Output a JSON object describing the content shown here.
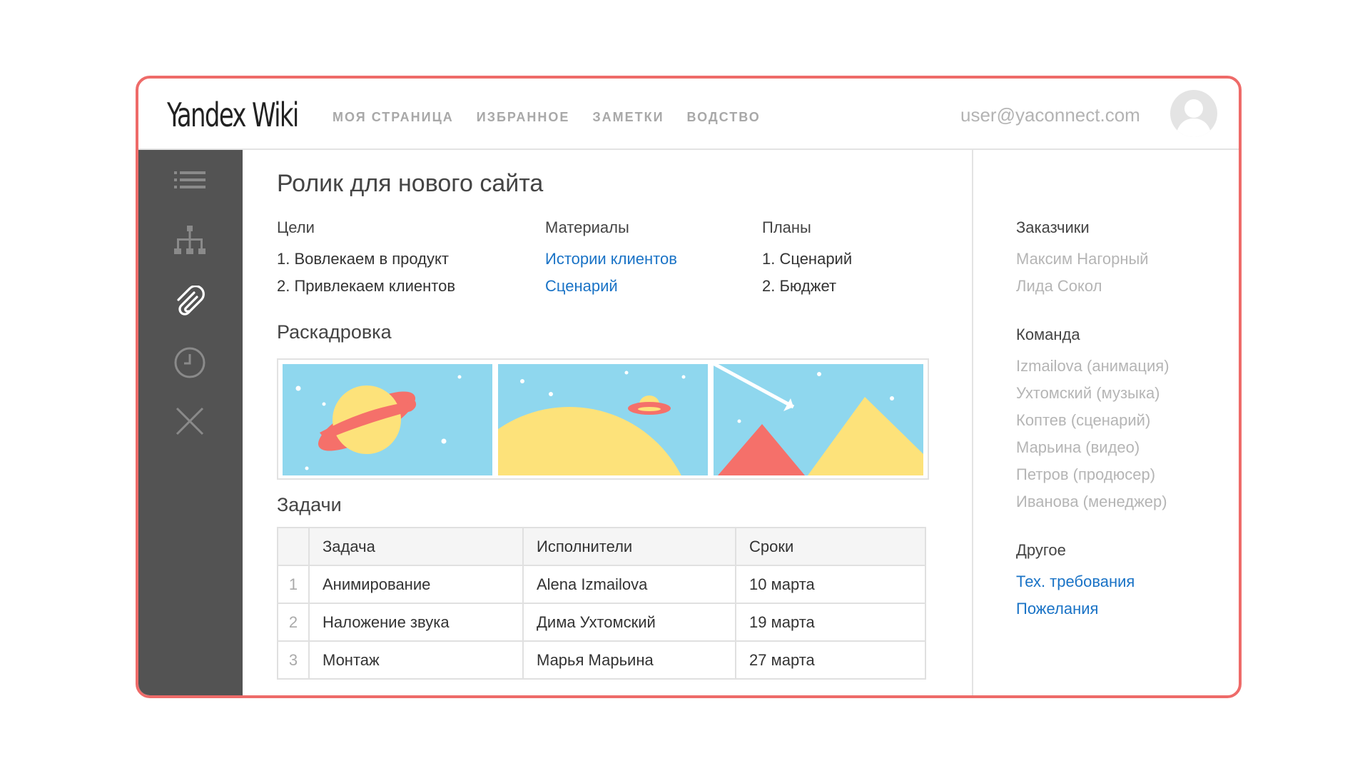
{
  "app": {
    "logo_main": "Yandex",
    "logo_sub": "Wiki"
  },
  "nav": {
    "items": [
      {
        "label": "МОЯ СТРАНИЦА"
      },
      {
        "label": "ИЗБРАННОЕ"
      },
      {
        "label": "ЗАМЕТКИ"
      },
      {
        "label": "ВОДСТВО"
      }
    ]
  },
  "user": {
    "email": "user@yaconnect.com",
    "avatar_icon": "user-silhouette-icon"
  },
  "sidebar": {
    "icons": [
      "list-icon",
      "structure-icon",
      "paperclip-icon",
      "clock-icon",
      "close-icon"
    ]
  },
  "page": {
    "title": "Ролик для нового сайта",
    "goals": {
      "heading": "Цели",
      "items": [
        "1. Вовлекаем в продукт",
        "2. Привлекаем клиентов"
      ]
    },
    "materials": {
      "heading": "Материалы",
      "links": [
        "Истории клиентов",
        "Сценарий"
      ]
    },
    "plans": {
      "heading": "Планы",
      "items": [
        "1. Сценарий",
        "2. Бюджет"
      ]
    },
    "storyboard": {
      "heading": "Раскадровка"
    },
    "tasks": {
      "heading": "Задачи",
      "columns": [
        "Задача",
        "Исполнители",
        "Сроки"
      ],
      "rows": [
        {
          "num": "1",
          "task": "Анимирование",
          "assignee": "Alena Izmailova",
          "deadline": "10 марта"
        },
        {
          "num": "2",
          "task": "Наложение звука",
          "assignee": "Дима Ухтомский",
          "deadline": "19 марта"
        },
        {
          "num": "3",
          "task": "Монтаж",
          "assignee": "Марья Марьина",
          "deadline": "27 марта"
        }
      ]
    }
  },
  "right_panel": {
    "customers": {
      "heading": "Заказчики",
      "items": [
        "Максим Нагорный",
        "Лида Сокол"
      ]
    },
    "team": {
      "heading": "Команда",
      "items": [
        "Izmailova (анимация)",
        "Ухтомский (музыка)",
        "Коптев (сценарий)",
        "Марьина (видео)",
        "Петров (продюсер)",
        "Иванова (менеджер)"
      ]
    },
    "other": {
      "heading": "Другое",
      "links": [
        "Тех. требования",
        "Пожелания"
      ]
    }
  },
  "colors": {
    "frame_border": "#ee6b69",
    "sidebar_bg": "#535353",
    "link": "#1a73c6",
    "sky": "#8fd7ee",
    "sun_yellow": "#fde27a",
    "coral": "#f5706a"
  }
}
